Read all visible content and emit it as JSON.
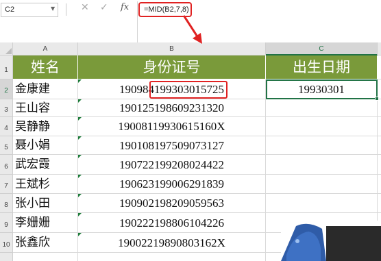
{
  "name_box": "C2",
  "formula": "=MID(B2,7,8)",
  "columns": [
    "A",
    "B",
    "C"
  ],
  "row_numbers": [
    "1",
    "2",
    "3",
    "4",
    "5",
    "6",
    "7",
    "8",
    "9",
    "10"
  ],
  "headers": {
    "name": "姓名",
    "id": "身份证号",
    "birth": "出生日期"
  },
  "rows": [
    {
      "name": "金康建",
      "id": "190984199303015725",
      "birth": "19930301"
    },
    {
      "name": "王山容",
      "id": "190125198609231320",
      "birth": ""
    },
    {
      "name": "吴静静",
      "id": "19008119930615160X",
      "birth": ""
    },
    {
      "name": "聂小娟",
      "id": "190108197509073127",
      "birth": ""
    },
    {
      "name": "武宏霞",
      "id": "190722199208024422",
      "birth": ""
    },
    {
      "name": "王斌杉",
      "id": "190623199006291839",
      "birth": ""
    },
    {
      "name": "张小田",
      "id": "190902198209059563",
      "birth": ""
    },
    {
      "name": "李姗姗",
      "id": "190222198806104226",
      "birth": ""
    },
    {
      "name": "张鑫欣",
      "id": "19002219890803162X",
      "birth": ""
    }
  ],
  "colors": {
    "header_fill": "#7a9a3a",
    "highlight": "#e02222",
    "selection": "#217346"
  },
  "icons": [
    "cancel-icon",
    "enter-icon",
    "function-icon",
    "arrow-icon"
  ]
}
